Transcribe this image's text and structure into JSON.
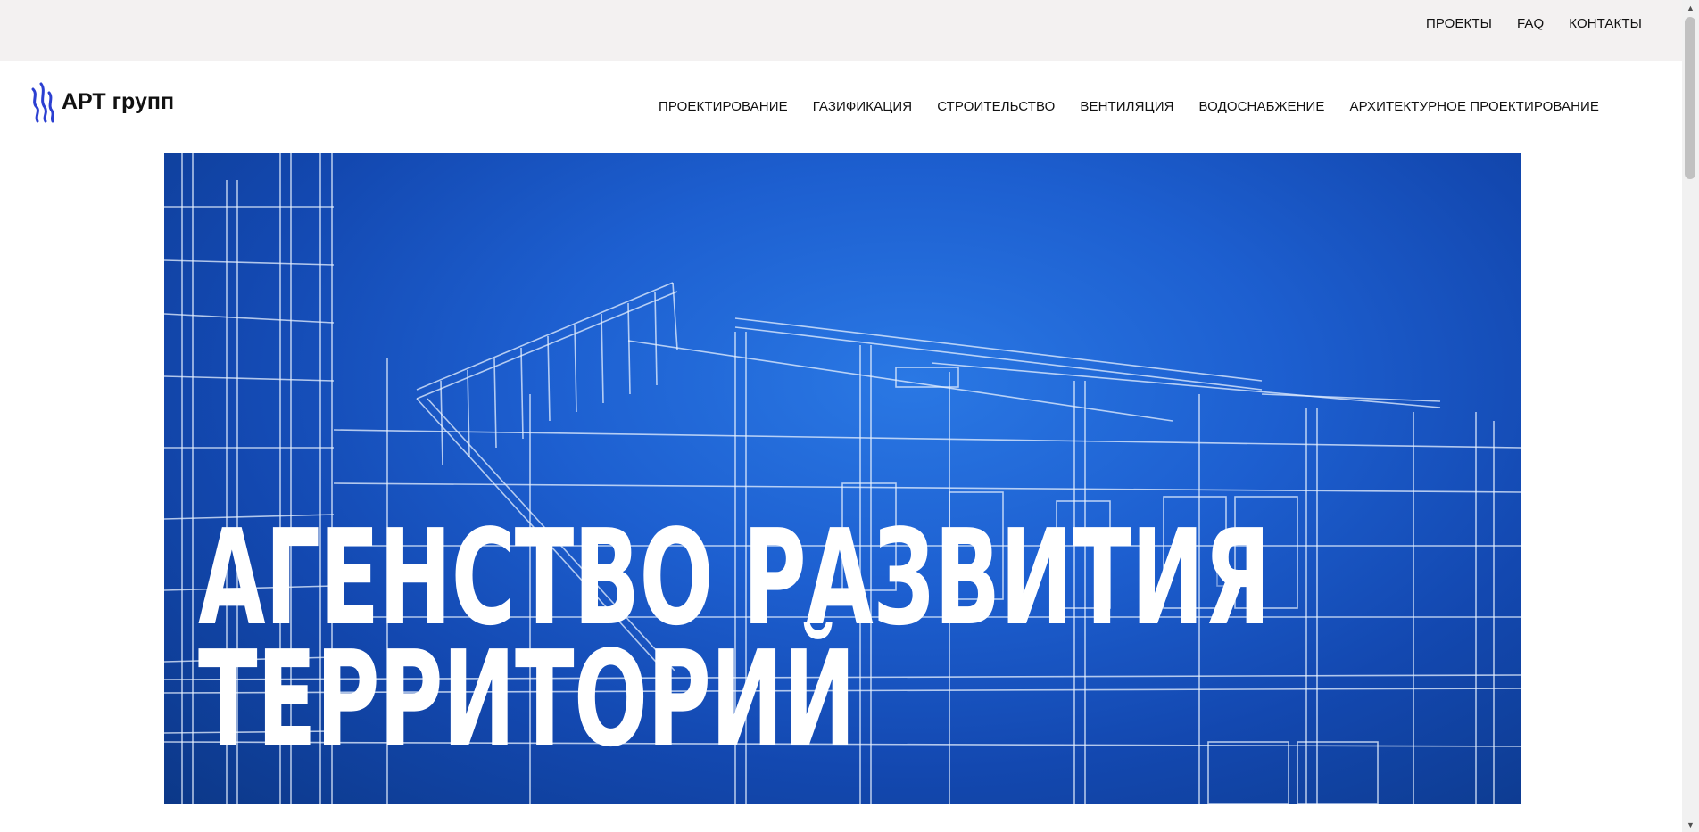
{
  "topbar": {
    "links": [
      "ПРОЕКТЫ",
      "FAQ",
      "КОНТАКТЫ"
    ]
  },
  "header": {
    "logo_text": "АРТ групп",
    "logo_icon": "wave-lines-icon",
    "nav": [
      "ПРОЕКТИРОВАНИЕ",
      "ГАЗИФИКАЦИЯ",
      "СТРОИТЕЛЬСТВО",
      "ВЕНТИЛЯЦИЯ",
      "ВОДОСНАБЖЕНИЕ",
      "АРХИТЕКТУРНОЕ ПРОЕКТИРОВАНИЕ"
    ]
  },
  "hero": {
    "title_line1": "АГЕНСТВО РАЗВИТИЯ",
    "title_line2": "ТЕРРИТОРИЙ",
    "background": "blueprint-building-wireframe"
  },
  "colors": {
    "topbar_bg": "#f3f1f1",
    "hero_blue": "#1d5fd0",
    "logo_blue": "#2b3fd1"
  }
}
